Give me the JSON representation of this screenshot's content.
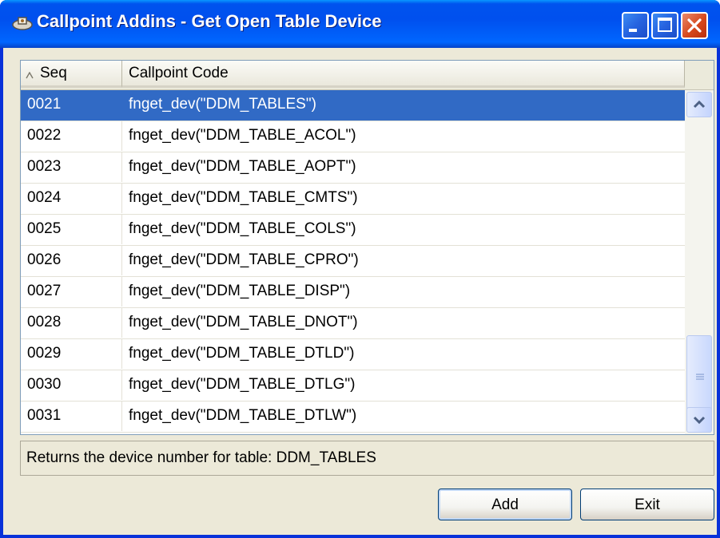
{
  "window": {
    "title": "Callpoint Addins - Get Open Table Device"
  },
  "grid": {
    "columns": [
      {
        "label": "Seq",
        "sorted": "ascending"
      },
      {
        "label": "Callpoint Code"
      }
    ],
    "rows": [
      {
        "seq": "0021",
        "code": "fnget_dev(\"DDM_TABLES\")",
        "selected": true
      },
      {
        "seq": "0022",
        "code": "fnget_dev(\"DDM_TABLE_ACOL\")"
      },
      {
        "seq": "0023",
        "code": "fnget_dev(\"DDM_TABLE_AOPT\")"
      },
      {
        "seq": "0024",
        "code": "fnget_dev(\"DDM_TABLE_CMTS\")"
      },
      {
        "seq": "0025",
        "code": "fnget_dev(\"DDM_TABLE_COLS\")"
      },
      {
        "seq": "0026",
        "code": "fnget_dev(\"DDM_TABLE_CPRO\")"
      },
      {
        "seq": "0027",
        "code": "fnget_dev(\"DDM_TABLE_DISP\")"
      },
      {
        "seq": "0028",
        "code": "fnget_dev(\"DDM_TABLE_DNOT\")"
      },
      {
        "seq": "0029",
        "code": "fnget_dev(\"DDM_TABLE_DTLD\")"
      },
      {
        "seq": "0030",
        "code": "fnget_dev(\"DDM_TABLE_DTLG\")"
      },
      {
        "seq": "0031",
        "code": "fnget_dev(\"DDM_TABLE_DTLW\")"
      }
    ]
  },
  "status": {
    "text": "Returns the device number for table: DDM_TABLES"
  },
  "buttons": {
    "add": "Add",
    "exit": "Exit"
  },
  "colors": {
    "titlebar": "#0053ee",
    "selection": "#316ac5",
    "face": "#ece9d8"
  }
}
